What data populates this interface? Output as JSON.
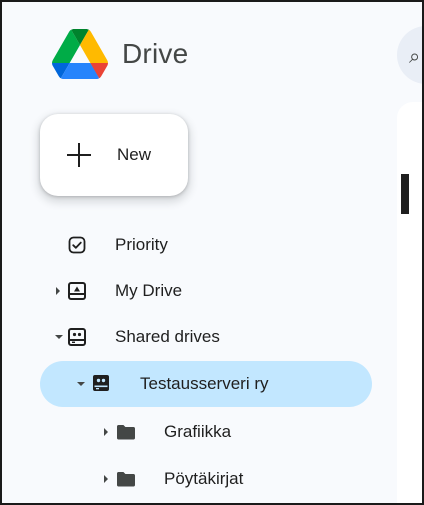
{
  "header": {
    "app_title": "Drive",
    "logo_icon": "google-drive-logo",
    "logo_colors": [
      "#0066da",
      "#00ac47",
      "#ea4335",
      "#00832d",
      "#2684fc",
      "#ffba00"
    ]
  },
  "new_button": {
    "label": "New",
    "icon": "plus-icon"
  },
  "nav": {
    "items": [
      {
        "label": "Priority",
        "icon": "priority-check-icon",
        "expander": "none"
      },
      {
        "label": "My Drive",
        "icon": "my-drive-icon",
        "expander": "collapsed"
      },
      {
        "label": "Shared drives",
        "icon": "shared-drives-icon",
        "expander": "expanded"
      },
      {
        "label": "Testausserveri ry",
        "icon": "shared-drive-icon",
        "expander": "expanded",
        "selected": true
      },
      {
        "label": "Grafiikka",
        "icon": "folder-icon",
        "expander": "collapsed"
      },
      {
        "label": "Pöytäkirjat",
        "icon": "folder-icon",
        "expander": "collapsed"
      }
    ]
  },
  "colors": {
    "selected_bg": "#c2e7ff",
    "sidebar_bg": "#f8fafd",
    "text": "#1f1f1f",
    "icon": "#444746"
  }
}
